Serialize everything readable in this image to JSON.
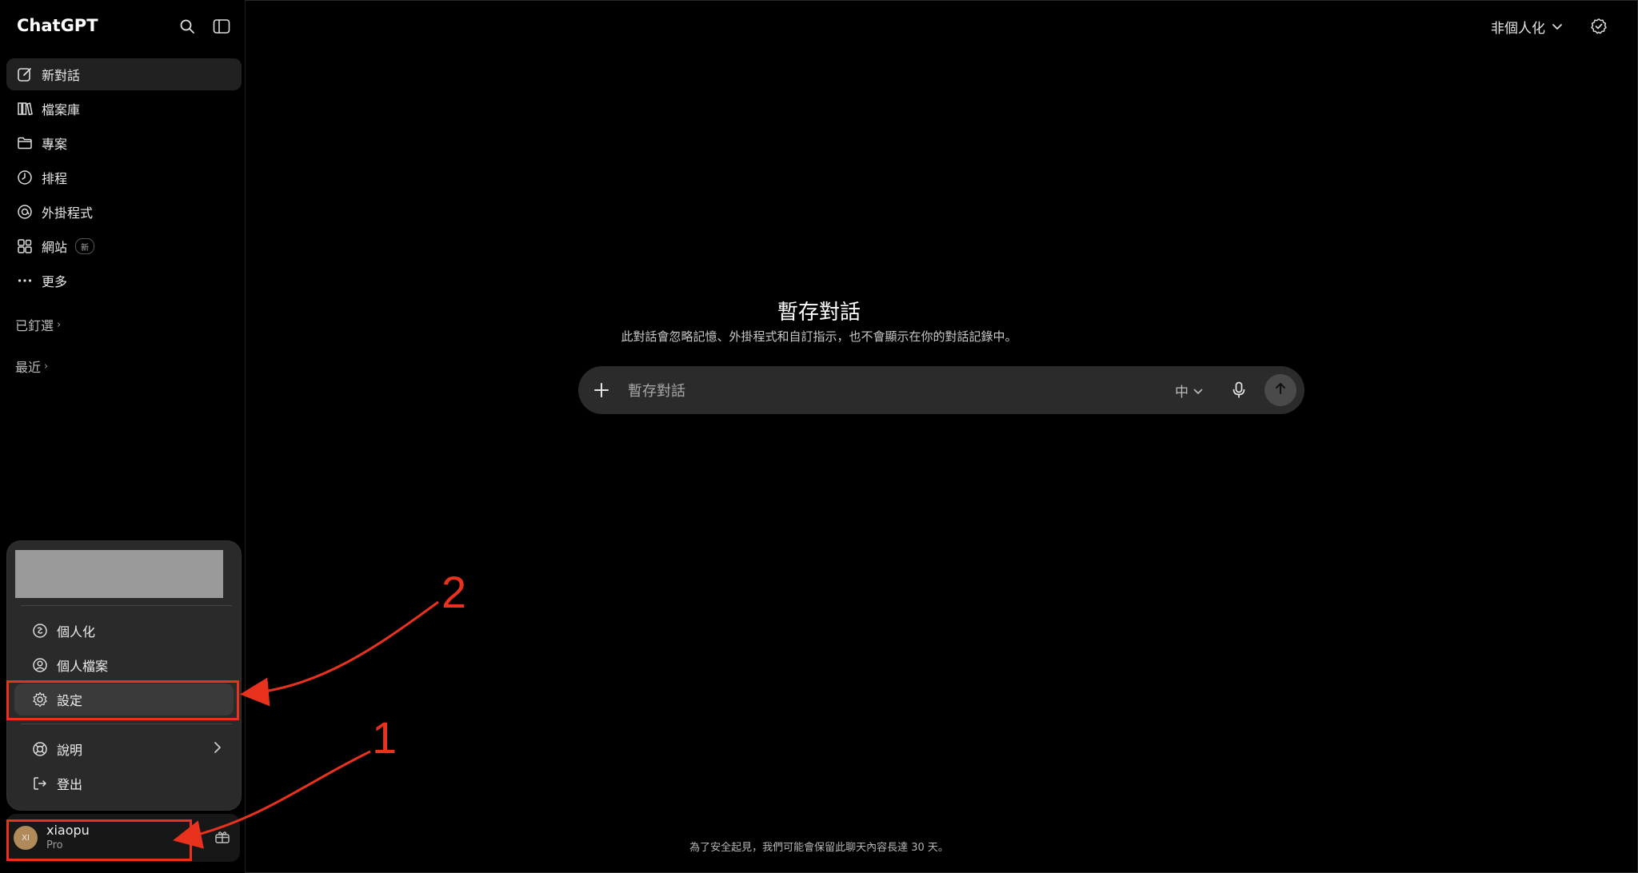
{
  "app": {
    "name": "ChatGPT"
  },
  "sidebar": {
    "items": [
      {
        "label": "新對話",
        "icon": "edit-icon"
      },
      {
        "label": "檔案庫",
        "icon": "library-icon"
      },
      {
        "label": "專案",
        "icon": "folder-icon"
      },
      {
        "label": "排程",
        "icon": "clock-icon"
      },
      {
        "label": "外掛程式",
        "icon": "plugin-icon"
      },
      {
        "label": "網站",
        "icon": "sites-icon",
        "badge": "新"
      },
      {
        "label": "更多",
        "icon": "more-icon"
      }
    ],
    "pinned_label": "已釘選",
    "recent_label": "最近"
  },
  "menu": {
    "items": [
      {
        "label": "個人化",
        "icon": "personalize-icon"
      },
      {
        "label": "個人檔案",
        "icon": "profile-icon"
      },
      {
        "label": "設定",
        "icon": "gear-icon"
      },
      {
        "label": "說明",
        "icon": "help-icon"
      },
      {
        "label": "登出",
        "icon": "logout-icon"
      }
    ]
  },
  "user": {
    "initials": "XI",
    "name": "xiaopu",
    "plan": "Pro"
  },
  "topbar": {
    "mode_label": "非個人化"
  },
  "main": {
    "title": "暫存對話",
    "subtitle": "此對話會忽略記憶、外掛程式和自訂指示，也不會顯示在你的對話記錄中。"
  },
  "composer": {
    "placeholder": "暫存對話",
    "lang": "中"
  },
  "footer": {
    "note": "為了安全起見，我們可能會保留此聊天內容長達 30 天。"
  },
  "annotations": {
    "label_1": "1",
    "label_2": "2",
    "color": "#e8321e"
  },
  "colors": {
    "background": "#000000",
    "menu": "#2a2a2a",
    "composer": "#2b2b2b"
  }
}
